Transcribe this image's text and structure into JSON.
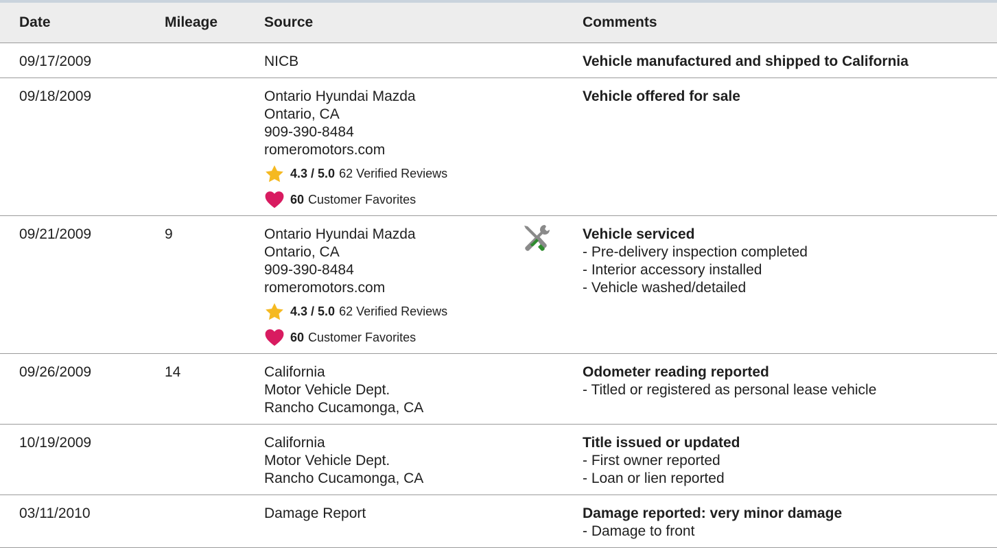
{
  "colors": {
    "header_bg": "#ededed",
    "top_border": "#c9d3dd",
    "row_divider": "#9a9a9a",
    "star": "#f5b921",
    "heart": "#d81b60",
    "wrench_green": "#2e8b2e",
    "tool_gray": "#8a8a8a"
  },
  "table": {
    "headers": {
      "date": "Date",
      "mileage": "Mileage",
      "source": "Source",
      "comments": "Comments"
    },
    "rows": [
      {
        "date": "09/17/2009",
        "mileage": "",
        "source": {
          "line1": "NICB"
        },
        "comments": {
          "title": "Vehicle manufactured and shipped to California"
        }
      },
      {
        "date": "09/18/2009",
        "mileage": "",
        "source": {
          "line1": "Ontario Hyundai Mazda",
          "line2": "Ontario, CA",
          "line3": "909-390-8484",
          "line4": "romeromotors.com",
          "rating": "4.3 / 5.0",
          "reviews": "62 Verified Reviews",
          "favorites_count": "60",
          "favorites_label": "Customer Favorites",
          "rating_icon": "star-icon",
          "favorites_icon": "heart-icon"
        },
        "comments": {
          "title": "Vehicle offered for sale"
        }
      },
      {
        "date": "09/21/2009",
        "mileage": "9",
        "icon": "service-tools-icon",
        "source": {
          "line1": "Ontario Hyundai Mazda",
          "line2": "Ontario, CA",
          "line3": "909-390-8484",
          "line4": "romeromotors.com",
          "rating": "4.3 / 5.0",
          "reviews": "62 Verified Reviews",
          "favorites_count": "60",
          "favorites_label": "Customer Favorites",
          "rating_icon": "star-icon",
          "favorites_icon": "heart-icon"
        },
        "comments": {
          "title": "Vehicle serviced",
          "detail1": "- Pre-delivery inspection completed",
          "detail2": "- Interior accessory installed",
          "detail3": "- Vehicle washed/detailed"
        }
      },
      {
        "date": "09/26/2009",
        "mileage": "14",
        "source": {
          "line1": "California",
          "line2": "Motor Vehicle Dept.",
          "line3": "Rancho Cucamonga, CA"
        },
        "comments": {
          "title": "Odometer reading reported",
          "detail1": "- Titled or registered as personal lease vehicle"
        }
      },
      {
        "date": "10/19/2009",
        "mileage": "",
        "source": {
          "line1": "California",
          "line2": "Motor Vehicle Dept.",
          "line3": "Rancho Cucamonga, CA"
        },
        "comments": {
          "title": "Title issued or updated",
          "detail1": "- First owner reported",
          "detail2": "- Loan or lien reported"
        }
      },
      {
        "date": "03/11/2010",
        "mileage": "",
        "source": {
          "line1": "Damage Report"
        },
        "comments": {
          "title": "Damage reported: very minor damage",
          "detail1": "- Damage to front"
        }
      }
    ]
  }
}
